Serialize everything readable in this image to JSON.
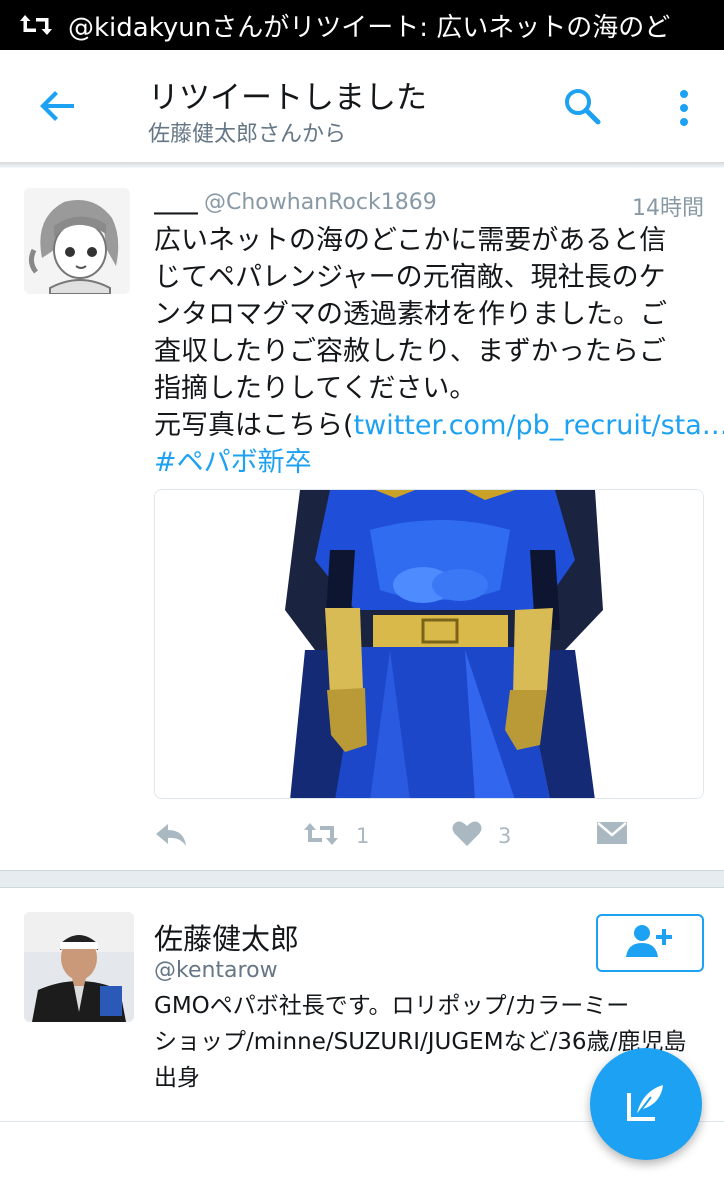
{
  "notification": {
    "icon": "retweet-icon",
    "text": "@kidakyunさんがリツイート: 広いネットの海のど"
  },
  "app_bar": {
    "title": "リツイートしました",
    "subtitle": "佐藤健太郎さんから"
  },
  "tweet": {
    "display_name": "____",
    "handle": "@ChowhanRock1869",
    "time": "14時間",
    "lines": [
      "広いネットの海のどこかに需要があると信",
      "じてペパレンジャーの元宿敵、現社長のケ",
      "ンタロマグマの透過素材を作りました。ご",
      "査収したりご容赦したり、まずかったらご",
      "指摘したりしてください。"
    ],
    "photo_prefix": "元写真はこちら(",
    "link_text": "twitter.com/pb_recruit/sta…",
    "photo_suffix": ")",
    "hashtag": "#ペパボ新卒",
    "retweet_count": "1",
    "like_count": "3"
  },
  "user_card": {
    "name": "佐藤健太郎",
    "handle": "@kentarow",
    "bio_lines": [
      "GMOペパボ社長です。ロリポップ/カラーミー",
      "ショップ/minne/SUZURI/JUGEMなど/36歳/鹿児島",
      "出身"
    ]
  },
  "colors": {
    "accent": "#1da1f2",
    "muted": "#8899a6",
    "text": "#14171a"
  }
}
